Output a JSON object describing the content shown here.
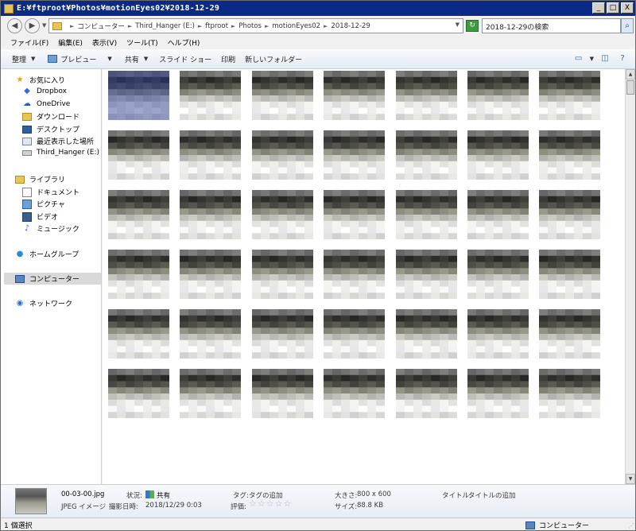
{
  "window": {
    "title": "E:¥ftproot¥Photos¥motionEyes02¥2018-12-29",
    "buttons": [
      "_",
      "□",
      "X"
    ]
  },
  "address": {
    "crumbs": [
      "コンピューター",
      "Third_Hanger (E:)",
      "ftproot",
      "Photos",
      "motionEyes02",
      "2018-12-29"
    ],
    "search_placeholder": "2018-12-29の検索"
  },
  "menu": [
    "ファイル(F)",
    "編集(E)",
    "表示(V)",
    "ツール(T)",
    "ヘルプ(H)"
  ],
  "toolbar": {
    "organize": "整理",
    "preview": "プレビュー",
    "share": "共有",
    "slideshow": "スライド ショー",
    "print": "印刷",
    "new_folder": "新しいフォルダー"
  },
  "nav": {
    "favorites": "お気に入り",
    "dropbox": "Dropbox",
    "onedrive": "OneDrive",
    "downloads": "ダウンロード",
    "desktop": "デスクトップ",
    "recent": "最近表示した場所",
    "third_hanger": "Third_Hanger (E:)",
    "libraries": "ライブラリ",
    "documents": "ドキュメント",
    "pictures": "ピクチャ",
    "videos": "ビデオ",
    "music": "ミュージック",
    "homegroup": "ホームグループ",
    "computer": "コンピューター",
    "network": "ネットワーク"
  },
  "details": {
    "filename": "00-03-00.jpg",
    "filetype": "JPEG イメージ",
    "state_label": "状況:",
    "state_value": "共有",
    "taken_label": "撮影日時:",
    "taken_value": "2018/12/29 0:03",
    "tag_label": "タグ:",
    "tag_value": "タグの追加",
    "rating_label": "評価:",
    "rating_stars": "☆☆☆☆☆",
    "size_label": "大きさ:",
    "size_value": "800 x 600",
    "filesize_label": "サイズ:",
    "filesize_value": "88.8 KB",
    "title_label": "タイトル:",
    "title_value": "タイトルの追加"
  },
  "status": {
    "selection": "1 個選択",
    "location": "コンピューター"
  },
  "thumbnails": {
    "count": 42,
    "selected_index": 0
  }
}
